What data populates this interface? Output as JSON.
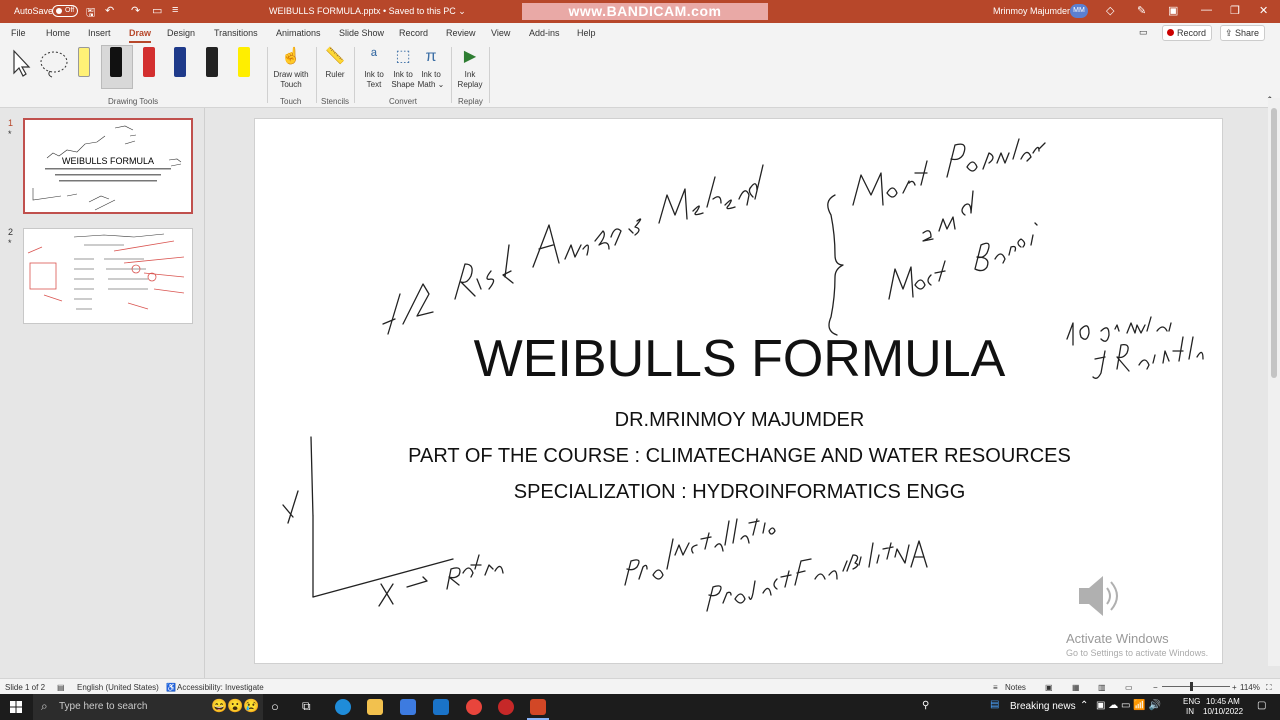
{
  "titlebar": {
    "autosave_label": "AutoSave",
    "autosave_state": "Off",
    "doc_title": "WEIBULLS FORMULA.pptx  •  Saved to this PC ⌄",
    "watermark": "www.BANDICAM.com",
    "user_name": "Mrinmoy Majumder",
    "user_initials": "MM"
  },
  "menu": {
    "tabs": [
      "File",
      "Home",
      "Insert",
      "Draw",
      "Design",
      "Transitions",
      "Animations",
      "Slide Show",
      "Record",
      "Review",
      "View",
      "Add-ins",
      "Help"
    ],
    "record": "Record",
    "share": "Share"
  },
  "ribbon": {
    "drawing_tools": "Drawing Tools",
    "draw_with_touch_1": "Draw with",
    "draw_with_touch_2": "Touch",
    "touch": "Touch",
    "ruler": "Ruler",
    "stencils": "Stencils",
    "ink_to_text_1": "Ink to",
    "ink_to_text_2": "Text",
    "ink_to_shape_1": "Ink to",
    "ink_to_shape_2": "Shape",
    "ink_to_math_1": "Ink to",
    "ink_to_math_2": "Math ⌄",
    "convert": "Convert",
    "ink_replay_1": "Ink",
    "ink_replay_2": "Replay",
    "replay": "Replay"
  },
  "slides_pane": {
    "slide1_num": "1",
    "slide2_num": "2",
    "star": "*",
    "thumb1_title": "WEIBULLS FORMULA"
  },
  "slide": {
    "title": "WEIBULLS FORMULA",
    "author": "DR.MRINMOY MAJUMDER",
    "course": "PART OF THE COURSE : CLIMATECHANGE AND WATER RESOURCES",
    "specialization": "SPECIALIZATION : HYDROINFORMATICS ENGG"
  },
  "watermark": {
    "line1": "Activate Windows",
    "line2": "Go to Settings to activate Windows."
  },
  "status": {
    "slide_info": "Slide 1 of 2",
    "language": "English (United States)",
    "accessibility": "Accessibility: Investigate",
    "notes": "Notes",
    "zoom": "114%"
  },
  "taskbar": {
    "search_placeholder": "Type here to search",
    "news": "Breaking news",
    "lang1": "ENG",
    "lang2": "IN",
    "time": "10:45 AM",
    "date": "10/10/2022"
  }
}
